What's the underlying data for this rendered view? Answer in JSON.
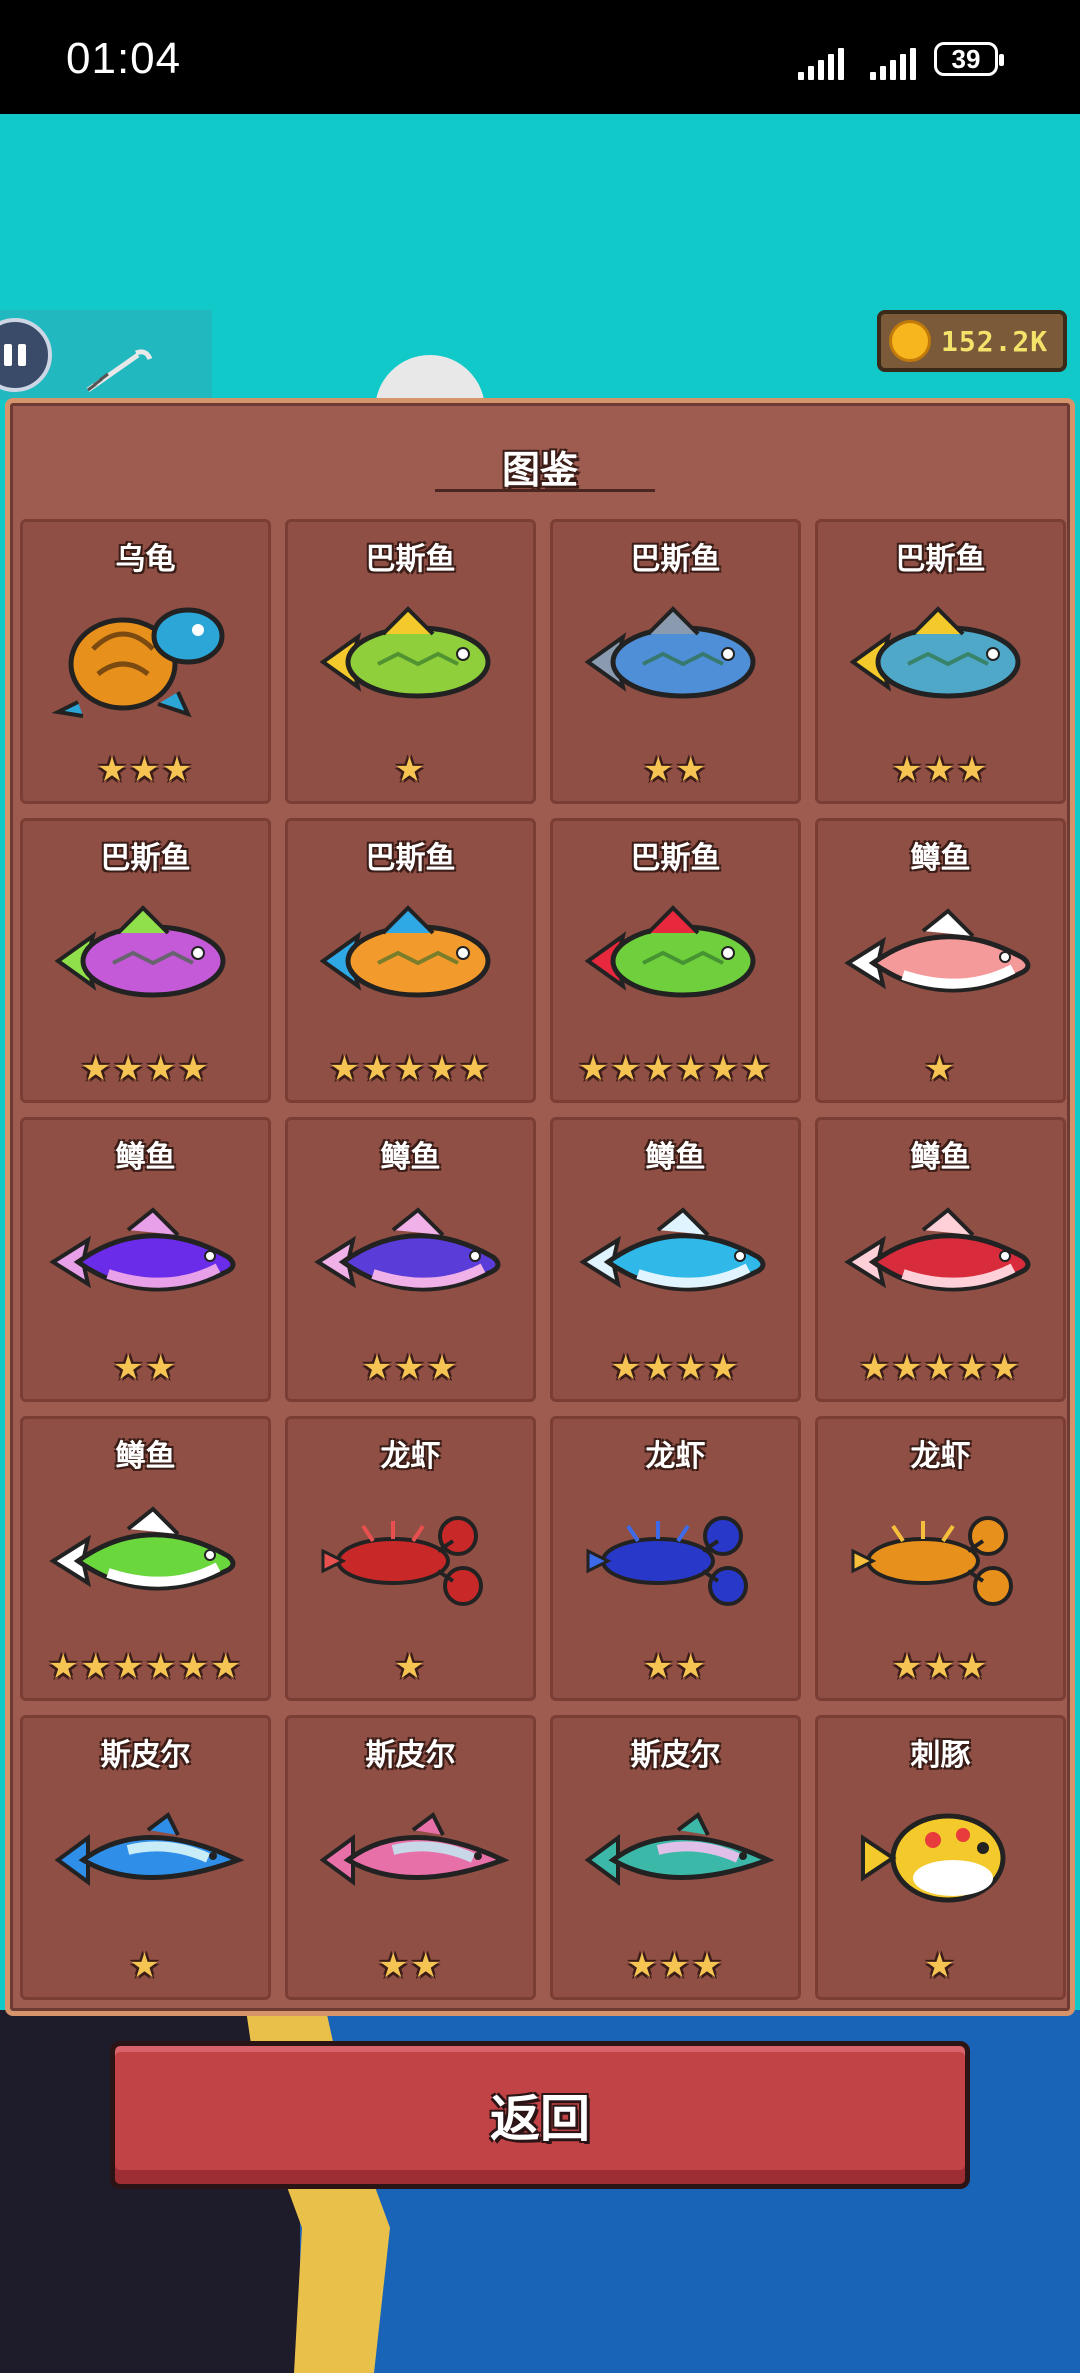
{
  "status_bar": {
    "time": "01:04",
    "battery": "39"
  },
  "coins": {
    "value": "152.2K"
  },
  "panel": {
    "title": "图鉴"
  },
  "cards": [
    {
      "name": "乌龟",
      "stars": 3,
      "icon": "turtle-icon",
      "colors": [
        "#e8901c",
        "#2ba6d6"
      ]
    },
    {
      "name": "巴斯鱼",
      "stars": 1,
      "icon": "bass-fish-icon",
      "colors": [
        "#8fcf3c",
        "#f3c92b"
      ]
    },
    {
      "name": "巴斯鱼",
      "stars": 2,
      "icon": "bass-fish-icon",
      "colors": [
        "#4f8fd8",
        "#8a9bb0"
      ]
    },
    {
      "name": "巴斯鱼",
      "stars": 3,
      "icon": "bass-fish-icon",
      "colors": [
        "#4fa8c8",
        "#f3c92b"
      ]
    },
    {
      "name": "巴斯鱼",
      "stars": 4,
      "icon": "bass-fish-icon",
      "colors": [
        "#c45ad8",
        "#8fe04a"
      ]
    },
    {
      "name": "巴斯鱼",
      "stars": 5,
      "icon": "bass-fish-icon",
      "colors": [
        "#f39a2c",
        "#2fa8e6"
      ]
    },
    {
      "name": "巴斯鱼",
      "stars": 6,
      "icon": "bass-fish-icon",
      "colors": [
        "#6fcf3c",
        "#e8283c"
      ]
    },
    {
      "name": "鳟鱼",
      "stars": 1,
      "icon": "trout-icon",
      "colors": [
        "#f49a9a",
        "#ffffff"
      ]
    },
    {
      "name": "鳟鱼",
      "stars": 2,
      "icon": "trout-icon",
      "colors": [
        "#6a2ce8",
        "#e8a0e8"
      ]
    },
    {
      "name": "鳟鱼",
      "stars": 3,
      "icon": "trout-icon",
      "colors": [
        "#5a3cd8",
        "#f0b0e8"
      ]
    },
    {
      "name": "鳟鱼",
      "stars": 4,
      "icon": "trout-icon",
      "colors": [
        "#2fb8e8",
        "#e0f4ff"
      ]
    },
    {
      "name": "鳟鱼",
      "stars": 5,
      "icon": "trout-icon",
      "colors": [
        "#d82c3c",
        "#ffd0d8"
      ]
    },
    {
      "name": "鳟鱼",
      "stars": 6,
      "icon": "trout-icon",
      "colors": [
        "#6ad83c",
        "#ffffff"
      ]
    },
    {
      "name": "龙虾",
      "stars": 1,
      "icon": "lobster-icon",
      "colors": [
        "#c82828",
        "#e85050"
      ]
    },
    {
      "name": "龙虾",
      "stars": 2,
      "icon": "lobster-icon",
      "colors": [
        "#2838c8",
        "#3c6ae8"
      ]
    },
    {
      "name": "龙虾",
      "stars": 3,
      "icon": "lobster-icon",
      "colors": [
        "#e8901c",
        "#f7c03c"
      ]
    },
    {
      "name": "斯皮尔",
      "stars": 1,
      "icon": "spear-fish-icon",
      "colors": [
        "#2f8fe8",
        "#c8ecf8"
      ]
    },
    {
      "name": "斯皮尔",
      "stars": 2,
      "icon": "spear-fish-icon",
      "colors": [
        "#e870a8",
        "#c8d8e8"
      ]
    },
    {
      "name": "斯皮尔",
      "stars": 3,
      "icon": "spear-fish-icon",
      "colors": [
        "#3cb8a8",
        "#e0c0e8"
      ]
    },
    {
      "name": "刺豚",
      "stars": 1,
      "icon": "pufferfish-icon",
      "colors": [
        "#f3c92b",
        "#e83c3c"
      ]
    }
  ],
  "back_button": {
    "label": "返回"
  }
}
